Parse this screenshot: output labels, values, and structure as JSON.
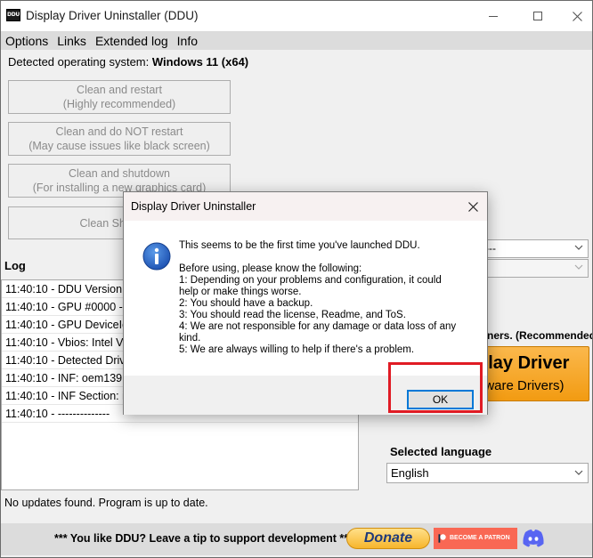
{
  "window": {
    "title": "Display Driver Uninstaller (DDU)",
    "icon_label": "DDU"
  },
  "menu": [
    "Options",
    "Links",
    "Extended log",
    "Info"
  ],
  "os": {
    "label": "Detected operating system:",
    "value": "Windows 11 (x64)"
  },
  "actions": [
    {
      "line1": "Clean and restart",
      "line2": "(Highly recommended)"
    },
    {
      "line1": "Clean and do NOT restart",
      "line2": "(May cause issues like black screen)"
    },
    {
      "line1": "Clean and shutdown",
      "line2": "(For installing a new graphics card)"
    },
    {
      "line1": "Clean Shader C"
    }
  ],
  "log": {
    "label": "Log",
    "lines": [
      "11:40:10 - DDU Version: 1",
      "11:40:10 - GPU #0000 - D",
      "11:40:10 - GPU DeviceId: ",
      "11:40:10 - Vbios: Intel Vid",
      "11:40:10 - Detected Drive",
      "11:40:10 - INF: oem139.in",
      "11:40:10 - INF Section: iC",
      "11:40:10 - --------------"
    ]
  },
  "status": "No updates found. Program is up to date.",
  "right_panel": {
    "select1_value": "----",
    "select2_value": "",
    "recommended_label": "ners. (Recommended)",
    "orange_line1": "play Driver",
    "orange_line2": "dware Drivers)"
  },
  "language": {
    "label": "Selected language",
    "value": "English"
  },
  "footer": {
    "text": "*** You like DDU? Leave a tip to support development ***",
    "donate_label": "Donate",
    "patreon_label": "BECOME A PATRON"
  },
  "dialog": {
    "title": "Display Driver Uninstaller",
    "message_lines": [
      "This seems to be the first time you've launched DDU.",
      "",
      "Before using, please know the following:",
      "1: Depending on your problems and configuration, it could",
      "help or make things worse.",
      "2: You should have a backup.",
      "3: You should read the license, Readme, and ToS.",
      "4: We are not responsible for any damage or data loss of any",
      "kind.",
      "5: We are always willing to help if there's a problem."
    ],
    "ok_label": "OK"
  },
  "colors": {
    "highlight": "#e01b24",
    "orange_button": "#f5a623",
    "patreon": "#f96854",
    "focus": "#0078d7"
  },
  "icons": [
    "app-icon",
    "minimize-icon",
    "maximize-icon",
    "close-icon",
    "chevron-down-icon",
    "info-icon",
    "patreon-icon",
    "discord-icon"
  ]
}
